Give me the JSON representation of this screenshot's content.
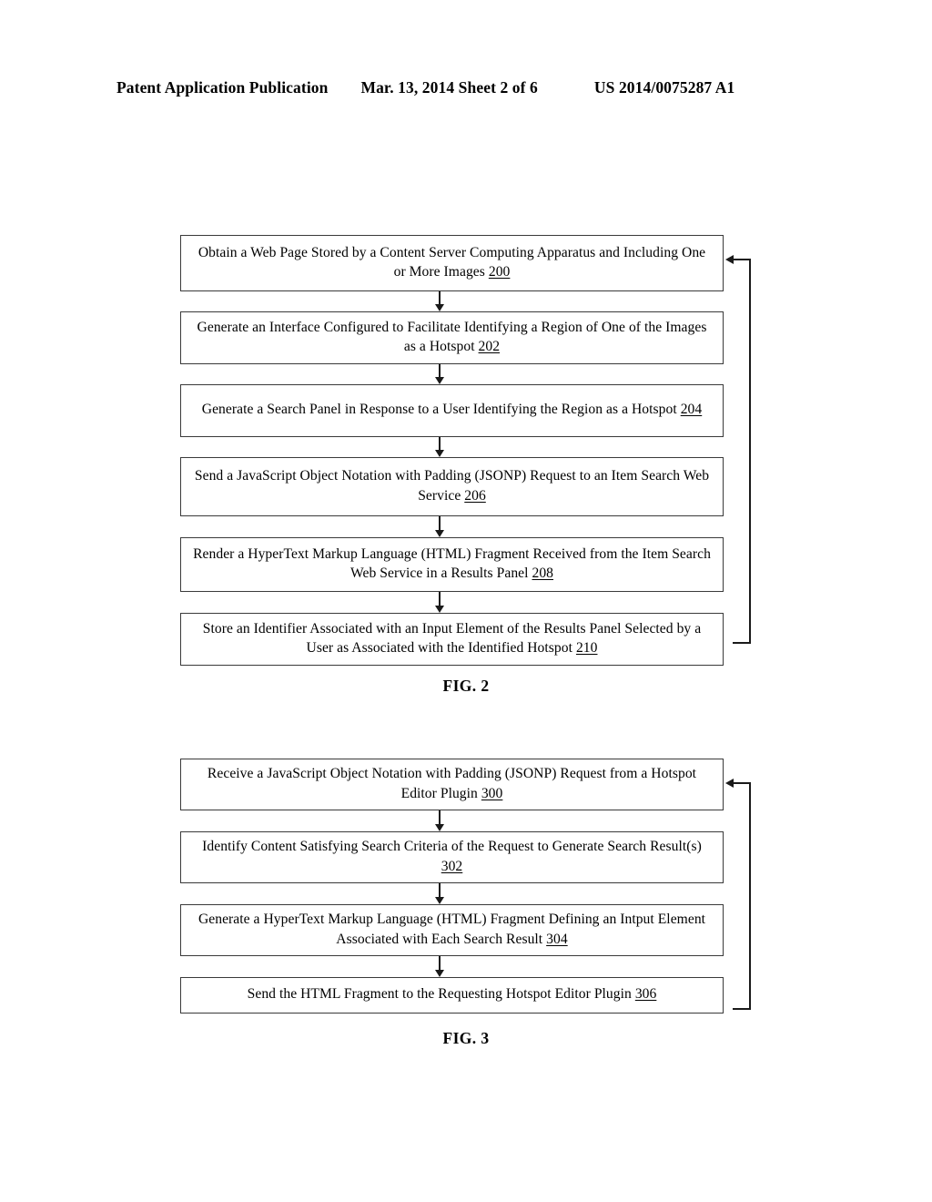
{
  "header": {
    "left": "Patent Application Publication",
    "middle": "Mar. 13, 2014  Sheet 2 of 6",
    "right": "US 2014/0075287 A1"
  },
  "figures": [
    {
      "caption": "FIG. 2",
      "steps": [
        {
          "text": "Obtain a Web Page Stored by a Content Server Computing Apparatus and Including One or More Images ",
          "ref": "200"
        },
        {
          "text": "Generate an Interface Configured to Facilitate Identifying a Region of One of the Images as a Hotspot ",
          "ref": "202"
        },
        {
          "text": "Generate a Search Panel in Response to a User Identifying the Region as a Hotspot ",
          "ref": "204"
        },
        {
          "text": "Send a JavaScript Object Notation with Padding (JSONP) Request to an Item Search Web Service ",
          "ref": "206"
        },
        {
          "text": "Render a HyperText Markup Language (HTML) Fragment Received from the Item Search Web Service in a Results Panel ",
          "ref": "208"
        },
        {
          "text": "Store an Identifier Associated with an Input Element of the Results Panel Selected by a User as Associated with the Identified Hotspot ",
          "ref": "210"
        }
      ]
    },
    {
      "caption": "FIG. 3",
      "steps": [
        {
          "text": "Receive a JavaScript Object Notation with Padding (JSONP) Request from a Hotspot Editor Plugin ",
          "ref": "300"
        },
        {
          "text": "Identify Content Satisfying Search Criteria of the Request to Generate Search Result(s) ",
          "ref": "302"
        },
        {
          "text": "Generate a HyperText Markup Language (HTML) Fragment Defining an Intput Element Associated with Each Search Result ",
          "ref": "304"
        },
        {
          "text": "Send the HTML Fragment to the Requesting Hotspot Editor Plugin ",
          "ref": "306"
        }
      ]
    }
  ]
}
